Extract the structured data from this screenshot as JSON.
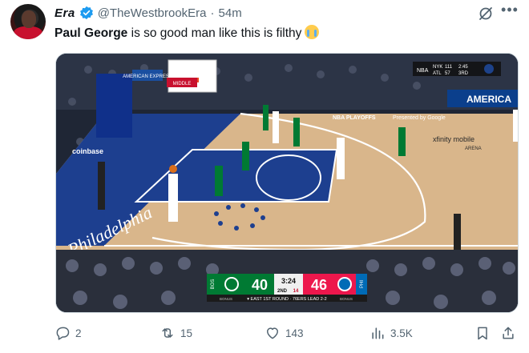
{
  "author": {
    "display_name": "Era",
    "handle": "@TheWestbrookEra",
    "separator": "·",
    "time": "54m"
  },
  "tweet": {
    "text_bold": "Paul George",
    "text_rest": " is so good man like this is filthy",
    "emoji": "loudly-crying-face"
  },
  "media": {
    "scoreboard": {
      "away_team": "BOS",
      "away_score": "40",
      "home_team": "PHI",
      "home_score": "46",
      "clock": "3:24",
      "period": "2ND",
      "shot_clock": "14",
      "ticker": "▾ EAST 1ST ROUND · 76ERS LEAD 2-2",
      "bonus_left": "BONUS",
      "bonus_right": "BONUS"
    },
    "corner_bug": {
      "league": "NBA",
      "team1": "NYK",
      "score1": "111",
      "team2": "ATL",
      "score2": "57",
      "clock": "2:45",
      "period": "3RD"
    },
    "court_text": {
      "playoffs": "NBA PLAYOFFS",
      "presented_by": "Presented by Google",
      "sponsor_right": "xfinity mobile",
      "arena": "ARENA",
      "city": "Philadelphia",
      "sponsor_left": "coinbase",
      "ad_amex": "AMERICAN EXPRESS",
      "ad_red": "AMERICA",
      "small_ad": "MIDDLE"
    }
  },
  "actions": {
    "replies": "2",
    "reposts": "15",
    "likes": "143",
    "views": "3.5K"
  },
  "colors": {
    "verified": "#1d9bf0",
    "muted": "#536471",
    "celtics_green": "#007a33",
    "sixers_red": "#ed174c",
    "sixers_blue": "#006bb6"
  }
}
